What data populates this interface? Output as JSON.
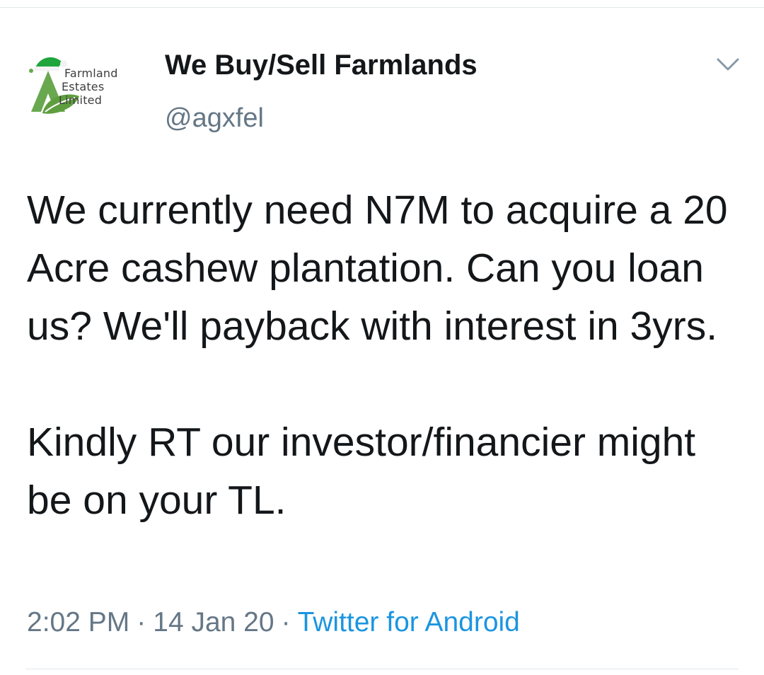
{
  "account": {
    "display_name": "We Buy/Sell Farmlands",
    "handle": "@agxfel",
    "avatar": {
      "logo_lines": [
        "Farmland",
        "Estates",
        "Limited"
      ],
      "colors": {
        "leaf": "#6aa84f",
        "hat": "#1fa53c",
        "text": "#3e3e3e"
      }
    }
  },
  "tweet": {
    "paragraphs": [
      "We currently need N7M to acquire a 20 Acre cashew plantation. Can you loan us? We'll payback with interest in 3yrs.",
      "Kindly RT our investor/financier might be on your TL."
    ]
  },
  "meta": {
    "time": "2:02 PM",
    "separator": "·",
    "date": "14 Jan 20",
    "source": "Twitter for Android"
  },
  "icons": {
    "menu": "chevron-down-icon"
  },
  "colors": {
    "text_primary": "#14171a",
    "text_secondary": "#657786",
    "link": "#1b95e0",
    "divider": "#e1e8ed"
  }
}
